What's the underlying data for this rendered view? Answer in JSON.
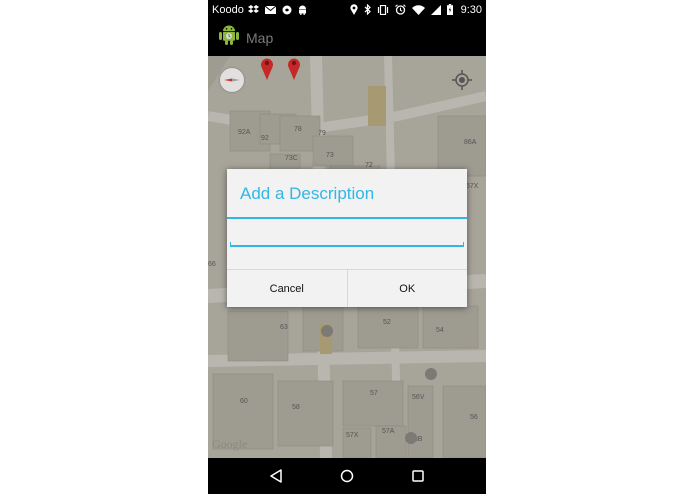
{
  "status_bar": {
    "carrier": "Koodo",
    "time": "9:30",
    "left_icons": [
      "dropbox-icon",
      "mail-icon",
      "app-icon",
      "android-icon"
    ],
    "right_icons": [
      "location-icon",
      "bluetooth-icon",
      "vibrate-icon",
      "alarm-icon",
      "wifi-icon",
      "signal-icon",
      "battery-icon"
    ]
  },
  "action_bar": {
    "title": "Map",
    "app_icon": "android-icon"
  },
  "map": {
    "attribution": "Google",
    "labels": [
      "92A",
      "92",
      "78",
      "79",
      "73C",
      "73",
      "72",
      "86A",
      "57X",
      "66",
      "63",
      "52",
      "54",
      "60",
      "58",
      "57",
      "56V",
      "56",
      "57X",
      "57A",
      "58B"
    ],
    "pins": 2,
    "controls": [
      "compass-icon",
      "my-location-icon"
    ]
  },
  "dialog": {
    "title": "Add a Description",
    "input_value": "",
    "cancel_label": "Cancel",
    "ok_label": "OK"
  },
  "nav_bar": {
    "buttons": [
      "back-icon",
      "home-icon",
      "recents-icon"
    ]
  },
  "colors": {
    "accent": "#33b5e5",
    "dialog_bg": "#f2f2f2",
    "map_bg": "#a7a49a",
    "bar_bg": "#000000"
  }
}
